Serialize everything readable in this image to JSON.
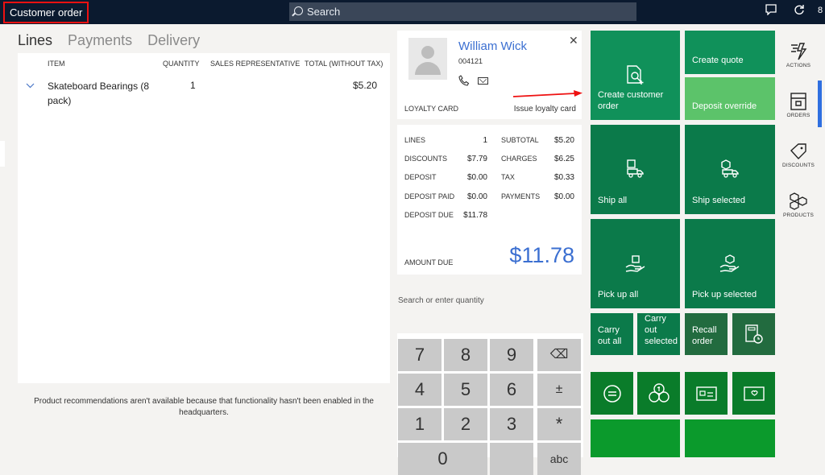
{
  "app": {
    "title": "Customer order",
    "search_placeholder": "Search",
    "user_initial": "8"
  },
  "tabs": [
    {
      "label": "Lines",
      "active": true
    },
    {
      "label": "Payments",
      "active": false
    },
    {
      "label": "Delivery",
      "active": false
    }
  ],
  "lines": {
    "headers": {
      "item": "ITEM",
      "quantity": "QUANTITY",
      "sales_rep": "SALES REPRESENTATIVE",
      "total": "TOTAL (WITHOUT TAX)"
    },
    "rows": [
      {
        "item": "Skateboard Bearings (8 pack)",
        "quantity": "1",
        "sales_rep": "",
        "total": "$5.20"
      }
    ]
  },
  "recommendation_note": "Product recommendations aren't available because that functionality hasn't been enabled in the headquarters.",
  "customer": {
    "name": "William Wick",
    "id": "004121",
    "loyalty_label": "LOYALTY CARD",
    "issue_loyalty": "Issue loyalty card"
  },
  "totals": {
    "lines_label": "LINES",
    "lines": "1",
    "discounts_label": "DISCOUNTS",
    "discounts": "$7.79",
    "deposit_label": "DEPOSIT",
    "deposit": "$0.00",
    "deposit_paid_label": "DEPOSIT PAID",
    "deposit_paid": "$0.00",
    "deposit_due_label": "DEPOSIT DUE",
    "deposit_due": "$11.78",
    "subtotal_label": "SUBTOTAL",
    "subtotal": "$5.20",
    "charges_label": "CHARGES",
    "charges": "$6.25",
    "tax_label": "TAX",
    "tax": "$0.33",
    "payments_label": "PAYMENTS",
    "payments": "$0.00",
    "amount_due_label": "AMOUNT DUE",
    "amount_due": "$11.78"
  },
  "numpad": {
    "placeholder": "Search or enter quantity",
    "keys": [
      "7",
      "8",
      "9",
      "⌫",
      "4",
      "5",
      "6",
      "±",
      "1",
      "2",
      "3",
      "*",
      "0",
      "",
      "",
      "abc"
    ]
  },
  "tiles": {
    "create_customer_order": "Create customer order",
    "create_quote": "Create quote",
    "deposit_override": "Deposit override",
    "ship_all": "Ship all",
    "ship_selected": "Ship selected",
    "pick_up_all": "Pick up all",
    "pick_up_selected": "Pick up selected",
    "carry_out_all": "Carry out all",
    "carry_out_selected": "Carry out selected",
    "recall_order": "Recall order"
  },
  "nav": {
    "actions": "ACTIONS",
    "orders": "ORDERS",
    "discounts": "DISCOUNTS",
    "products": "PRODUCTS"
  },
  "colors": {
    "topbar": "#0b1a2f",
    "tile_green": "#10915a",
    "tile_dark_green": "#0b7a4a",
    "tile_light_green": "#5cc36a",
    "tile_darker": "#226b3f",
    "payment_green": "#0a7c2a",
    "accent_blue": "#3b6fd1"
  }
}
